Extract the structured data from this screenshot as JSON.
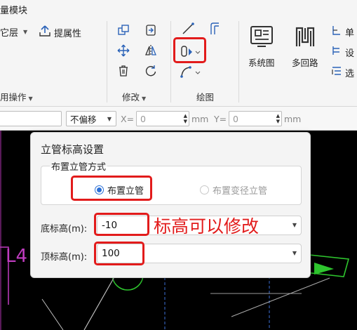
{
  "ribbon": {
    "title": "量模块",
    "row1_left": "它层",
    "extract_attr": "提属性",
    "group_ops": "用操作",
    "group_modify": "修改",
    "group_draw": "绘图",
    "system_diagram": "系统图",
    "multi_loop": "多回路",
    "right_r1": "单",
    "right_r2": "设",
    "right_r3": "选"
  },
  "toolbar": {
    "offset_value": "不偏移",
    "x_label": "X=",
    "x_value": "0",
    "mm1": "mm",
    "y_label": "Y=",
    "y_value": "0",
    "mm2": "mm"
  },
  "canvas": {
    "text_fragment": "L4"
  },
  "dialog": {
    "title": "立管标高设置",
    "method_legend": "布置立管方式",
    "option_riser": "布置立管",
    "option_reducer": "布置变径立管",
    "bottom_label": "底标高(m):",
    "bottom_value": "-10",
    "top_label": "顶标高(m):",
    "top_value": "100"
  },
  "annotation": {
    "text": "标高可以修改"
  },
  "colors": {
    "highlight": "#e21b1b",
    "radio_blue": "#2a6fd6",
    "canvas_bg": "#000000"
  }
}
